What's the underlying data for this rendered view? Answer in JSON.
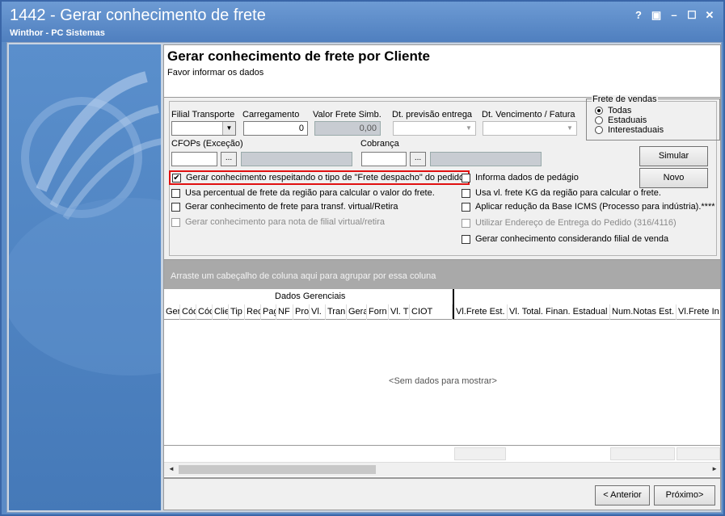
{
  "window": {
    "title": "1442 - Gerar conhecimento de frete",
    "subtitle": "Winthor - PC Sistemas",
    "help": "?",
    "restore": "▣",
    "minimize": "–",
    "maximize": "☐",
    "close": "✕"
  },
  "header": {
    "title": "Gerar conhecimento de frete por Cliente",
    "subtitle": "Favor informar os dados"
  },
  "form": {
    "filial_label": "Filial Transporte",
    "carregamento_label": "Carregamento",
    "carregamento_value": "0",
    "valor_frete_label": "Valor Frete Simb.",
    "valor_frete_value": "0,00",
    "dt_previsao_label": "Dt. previsão entrega",
    "dt_vencimento_label": "Dt. Vencimento / Fatura",
    "cfops_label": "CFOPs (Exceção)",
    "cobranca_label": "Cobrança",
    "search_btn": "...",
    "frete_vendas": {
      "legend": "Frete de vendas",
      "options": [
        "Todas",
        "Estaduais",
        "Interestaduais"
      ],
      "selected": "Todas"
    },
    "checks_left": [
      {
        "label": "Gerar conhecimento respeitando o tipo de \"Frete despacho\" do pedido.",
        "checked": true
      },
      {
        "label": "Usa percentual de frete da região para calcular o valor do frete.",
        "checked": false
      },
      {
        "label": "Gerar conhecimento de frete para transf. virtual/Retira",
        "checked": false
      },
      {
        "label": "Gerar conhecimento para nota de filial virtual/retira",
        "checked": false,
        "disabled": true
      }
    ],
    "checks_right": [
      {
        "label": "Informa dados de pedágio",
        "checked": false
      },
      {
        "label": "Usa vl. frete KG da região para calcular o frete.",
        "checked": false
      },
      {
        "label": "Aplicar redução da Base ICMS (Processo para indústria).****",
        "checked": false
      },
      {
        "label": "Utilizar Endereço de Entrega do Pedido (316/4116)",
        "checked": false,
        "disabled": true
      },
      {
        "label": "Gerar conhecimento considerando filial de venda",
        "checked": false
      }
    ],
    "simular_btn": "Simular",
    "novo_btn": "Novo",
    "check_mark": "✔"
  },
  "grid": {
    "group_hint": "Arraste um cabeçalho de coluna aqui para agrupar por essa coluna",
    "band_label": "Dados Gerenciais",
    "columns": [
      "Ger",
      "Cód",
      "Cód",
      "Clie",
      "Tip",
      "Rec",
      "Pag",
      "NF",
      "Pro",
      "Vl.",
      "Tran",
      "Gera",
      "Forn",
      "Vl. T",
      "CIOT",
      "Vl.Frete Est.",
      "Vl. Total. Finan. Estadual",
      "Num.Notas Est.",
      "Vl.Frete In"
    ],
    "empty_text": "<Sem dados para mostrar>",
    "scroll_left": "◄",
    "scroll_right": "►"
  },
  "footer": {
    "anterior_btn": "< Anterior",
    "proximo_btn": "Próximo>"
  }
}
